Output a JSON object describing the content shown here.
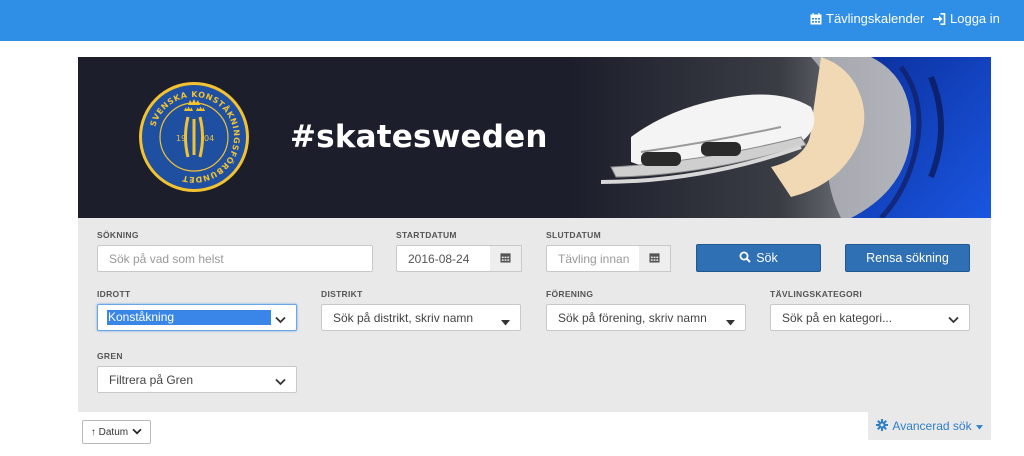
{
  "topnav": {
    "calendar_label": "Tävlingskalender",
    "login_label": "Logga in",
    "calendar_icon": "calendar-icon",
    "login_icon": "sign-in-icon"
  },
  "banner": {
    "hashtag": "#skatesweden",
    "logo": {
      "ring_text": "SVENSKA KONSTÅKNINGSFÖRBUNDET",
      "year_left": "19",
      "year_right": "04"
    }
  },
  "search": {
    "query_label": "SÖKNING",
    "query_placeholder": "Sök på vad som helst",
    "start_label": "STARTDATUM",
    "start_value": "2016-08-24",
    "end_label": "SLUTDATUM",
    "end_placeholder": "Tävling innan",
    "search_button": "Sök",
    "clear_button": "Rensa sökning",
    "sport_label": "IDROTT",
    "sport_value": "Konståkning",
    "district_label": "DISTRIKT",
    "district_placeholder": "Sök på distrikt, skriv namn",
    "club_label": "FÖRENING",
    "club_placeholder": "Sök på förening, skriv namn",
    "category_label": "TÄVLINGSKATEGORI",
    "category_placeholder": "Sök på en kategori...",
    "branch_label": "GREN",
    "branch_placeholder": "Filtrera på Gren"
  },
  "sort": {
    "label": "↑ Datum"
  },
  "advanced": {
    "label": "Avancerad sök"
  },
  "colors": {
    "topbar": "#2f8ee6",
    "primary_button": "#2f6fb3",
    "banner_bg": "#1c1f2b",
    "logo_blue": "#1f4fa0",
    "logo_gold": "#f2c230"
  }
}
